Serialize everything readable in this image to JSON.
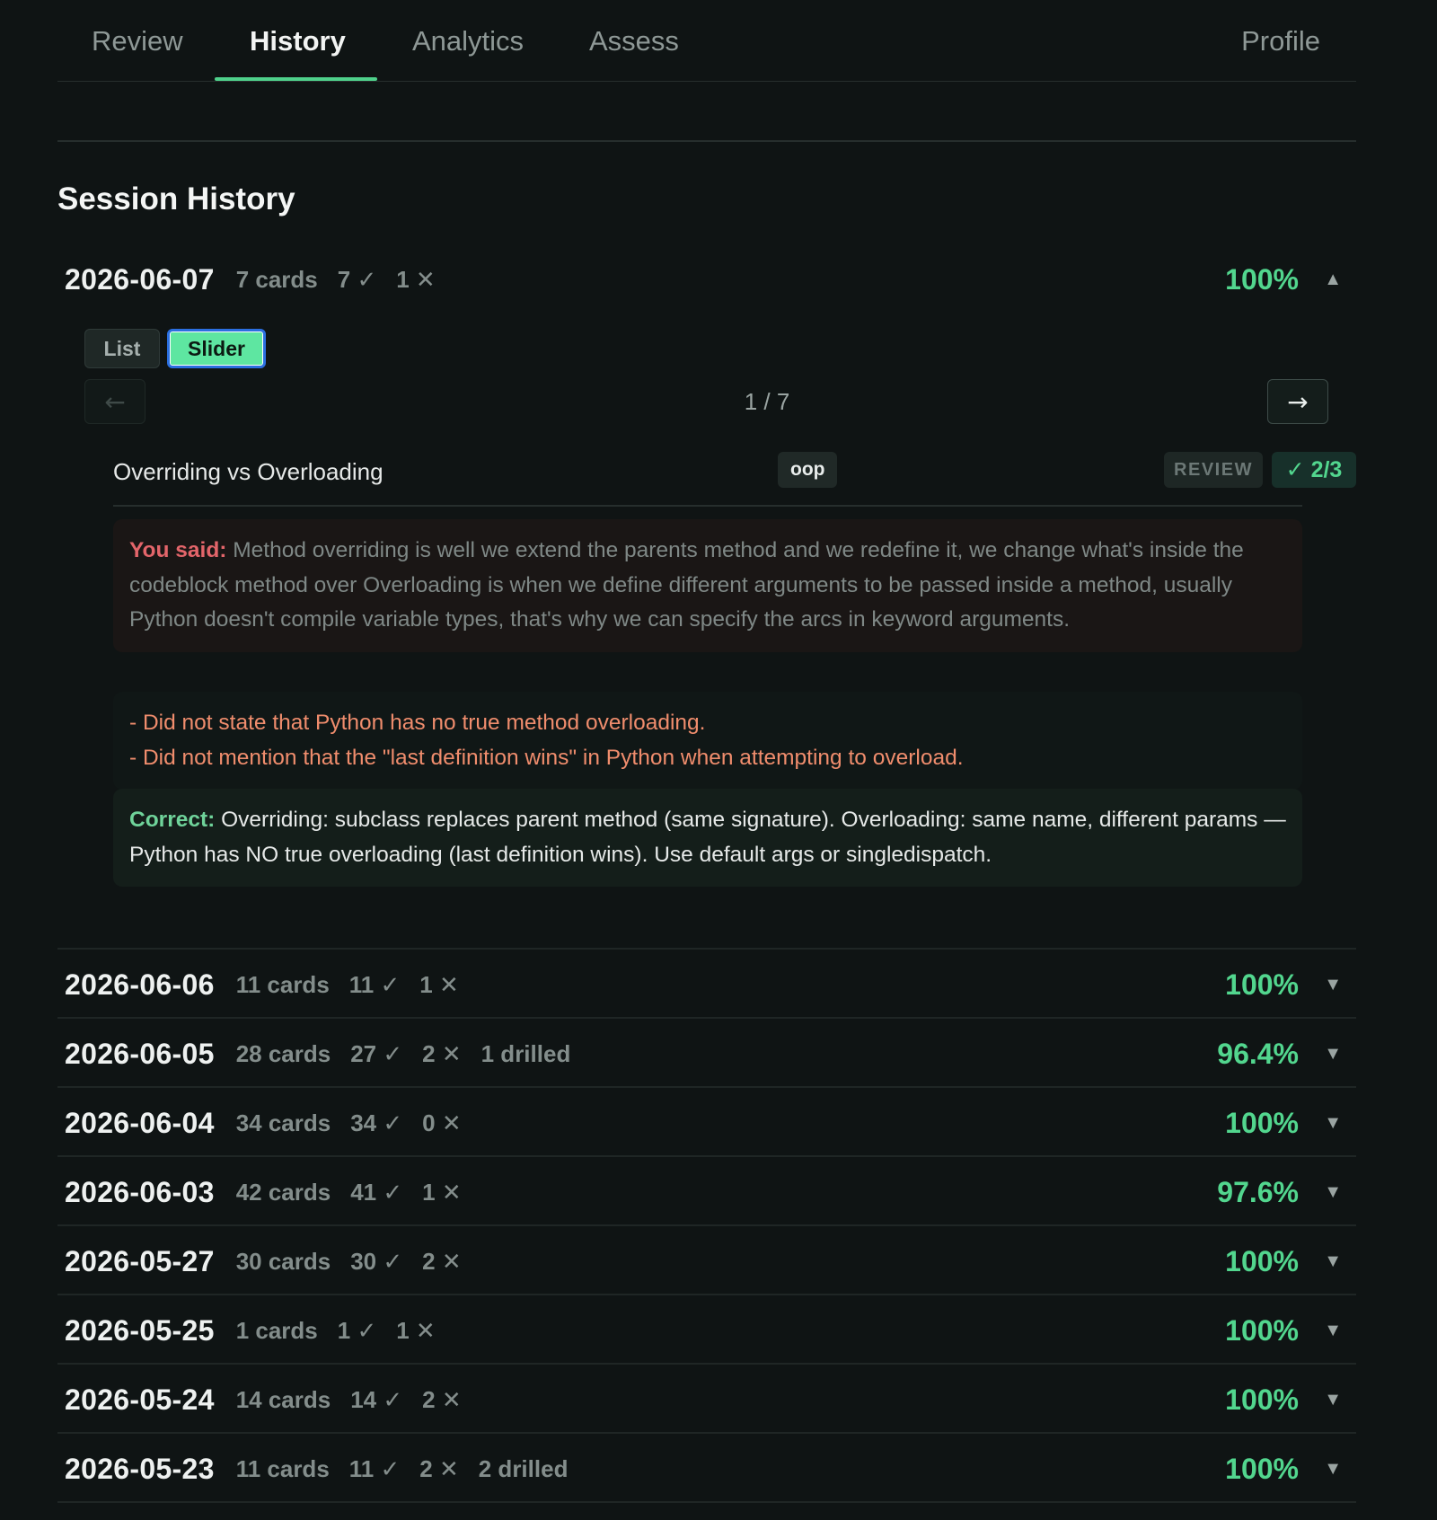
{
  "tabs": [
    {
      "label": "Review",
      "active": false
    },
    {
      "label": "History",
      "active": true
    },
    {
      "label": "Analytics",
      "active": false
    },
    {
      "label": "Assess",
      "active": false
    }
  ],
  "profile_label": "Profile",
  "accent_color": "#4fd18b",
  "section_title": "Session History",
  "expanded_session": {
    "date": "2026-06-07",
    "cards": "7 cards",
    "correct": "7 ✓",
    "wrong": "1 ✕",
    "percent": "100%",
    "caret": "▲",
    "modes": {
      "list": "List",
      "slider": "Slider",
      "selected": "Slider"
    },
    "prev_arrow": "←",
    "next_arrow": "→",
    "pager": "1 / 7",
    "card": {
      "title": "Overriding vs Overloading",
      "tag": "oop",
      "badge": "REVIEW",
      "score": "✓ 2/3",
      "you_said_label": "You said:",
      "you_said": "Method overriding is well we extend the parents method and we redefine it, we change what's inside the codeblock method over Overloading is when we define different arguments to be passed inside a method, usually Python doesn't compile variable types, that's why we can specify the arcs in keyword arguments.",
      "missed": [
        "- Did not state that Python has no true method overloading.",
        "- Did not mention that the \"last definition wins\" in Python when attempting to overload."
      ],
      "correct_label": "Correct:",
      "correct": "Overriding: subclass replaces parent method (same signature). Overloading: same name, different params — Python has NO true overloading (last definition wins). Use default args or singledispatch."
    }
  },
  "sessions": [
    {
      "date": "2026-06-06",
      "cards": "11 cards",
      "correct": "11 ✓",
      "wrong": "1 ✕",
      "drilled": "",
      "percent": "100%"
    },
    {
      "date": "2026-06-05",
      "cards": "28 cards",
      "correct": "27 ✓",
      "wrong": "2 ✕",
      "drilled": "1 drilled",
      "percent": "96.4%"
    },
    {
      "date": "2026-06-04",
      "cards": "34 cards",
      "correct": "34 ✓",
      "wrong": "0 ✕",
      "drilled": "",
      "percent": "100%"
    },
    {
      "date": "2026-06-03",
      "cards": "42 cards",
      "correct": "41 ✓",
      "wrong": "1 ✕",
      "drilled": "",
      "percent": "97.6%"
    },
    {
      "date": "2026-05-27",
      "cards": "30 cards",
      "correct": "30 ✓",
      "wrong": "2 ✕",
      "drilled": "",
      "percent": "100%"
    },
    {
      "date": "2026-05-25",
      "cards": "1 cards",
      "correct": "1 ✓",
      "wrong": "1 ✕",
      "drilled": "",
      "percent": "100%"
    },
    {
      "date": "2026-05-24",
      "cards": "14 cards",
      "correct": "14 ✓",
      "wrong": "2 ✕",
      "drilled": "",
      "percent": "100%"
    },
    {
      "date": "2026-05-23",
      "cards": "11 cards",
      "correct": "11 ✓",
      "wrong": "2 ✕",
      "drilled": "2 drilled",
      "percent": "100%"
    }
  ],
  "collapsed_caret": "▼"
}
